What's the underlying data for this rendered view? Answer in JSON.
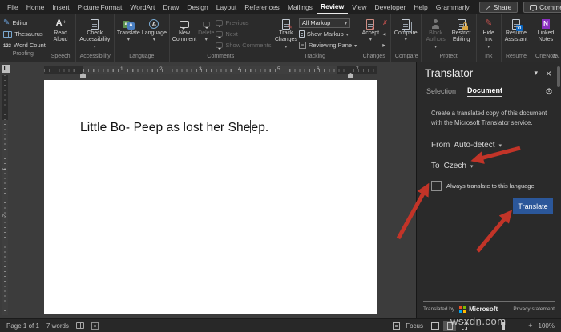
{
  "titlebar": {
    "tabs": [
      "File",
      "Home",
      "Insert",
      "Picture Format",
      "WordArt",
      "Draw",
      "Design",
      "Layout",
      "References",
      "Mailings",
      "Review",
      "View",
      "Developer",
      "Help",
      "Grammarly"
    ],
    "active_tab": "Review",
    "share_label": "Share",
    "comments_label": "Comments"
  },
  "ribbon": {
    "groups": {
      "proofing": {
        "label": "Proofing",
        "editor": "Editor",
        "thesaurus": "Thesaurus",
        "word_count": "Word Count"
      },
      "speech": {
        "label": "Speech",
        "read_aloud": "Read Aloud"
      },
      "accessibility": {
        "label": "Accessibility",
        "check_accessibility": "Check Accessibility"
      },
      "language": {
        "label": "Language",
        "translate": "Translate",
        "language": "Language"
      },
      "comments": {
        "label": "Comments",
        "new_comment": "New Comment",
        "delete": "Delete",
        "previous": "Previous",
        "next": "Next",
        "show_comments": "Show Comments"
      },
      "tracking": {
        "label": "Tracking",
        "track_changes": "Track Changes",
        "display_mode": "All Markup",
        "show_markup": "Show Markup",
        "reviewing_pane": "Reviewing Pane"
      },
      "changes": {
        "label": "Changes",
        "accept": "Accept"
      },
      "compare": {
        "label": "Compare",
        "compare": "Compare"
      },
      "protect": {
        "label": "Protect",
        "block_authors": "Block Authors",
        "restrict_editing": "Restrict Editing"
      },
      "ink": {
        "label": "Ink",
        "hide_ink": "Hide Ink"
      },
      "resume": {
        "label": "Resume",
        "resume_assistant": "Resume Assistant"
      },
      "onenote": {
        "label": "OneNote",
        "linked_notes": "Linked Notes"
      }
    }
  },
  "ruler": {
    "numbers": [
      "1",
      "2",
      "3",
      "4",
      "5",
      "6",
      "7"
    ],
    "vertical_numbers": [
      "1",
      "2"
    ]
  },
  "document": {
    "text_before_cursor": "Little Bo- Peep as lost her She",
    "text_after_cursor": "ep."
  },
  "translator": {
    "title": "Translator",
    "tab_selection": "Selection",
    "tab_document": "Document",
    "description": "Create a translated copy of this document with the Microsoft Translator service.",
    "from_label": "From",
    "from_value": "Auto-detect",
    "to_label": "To",
    "to_value": "Czech",
    "always_translate_label": "Always translate to this language",
    "translate_button": "Translate",
    "footer_translated_by": "Translated by",
    "footer_brand": "Microsoft",
    "footer_privacy": "Privacy statement"
  },
  "status_bar": {
    "page_info": "Page 1 of 1",
    "word_count": "7 words",
    "focus_label": "Focus",
    "zoom_value": "100%"
  },
  "watermark": "wsxdn.com",
  "colors": {
    "accent_blue": "#2b579a",
    "arrow_red": "#c23428",
    "onenote_purple": "#8a2ec0",
    "linkedin_blue": "#0a66c2"
  }
}
